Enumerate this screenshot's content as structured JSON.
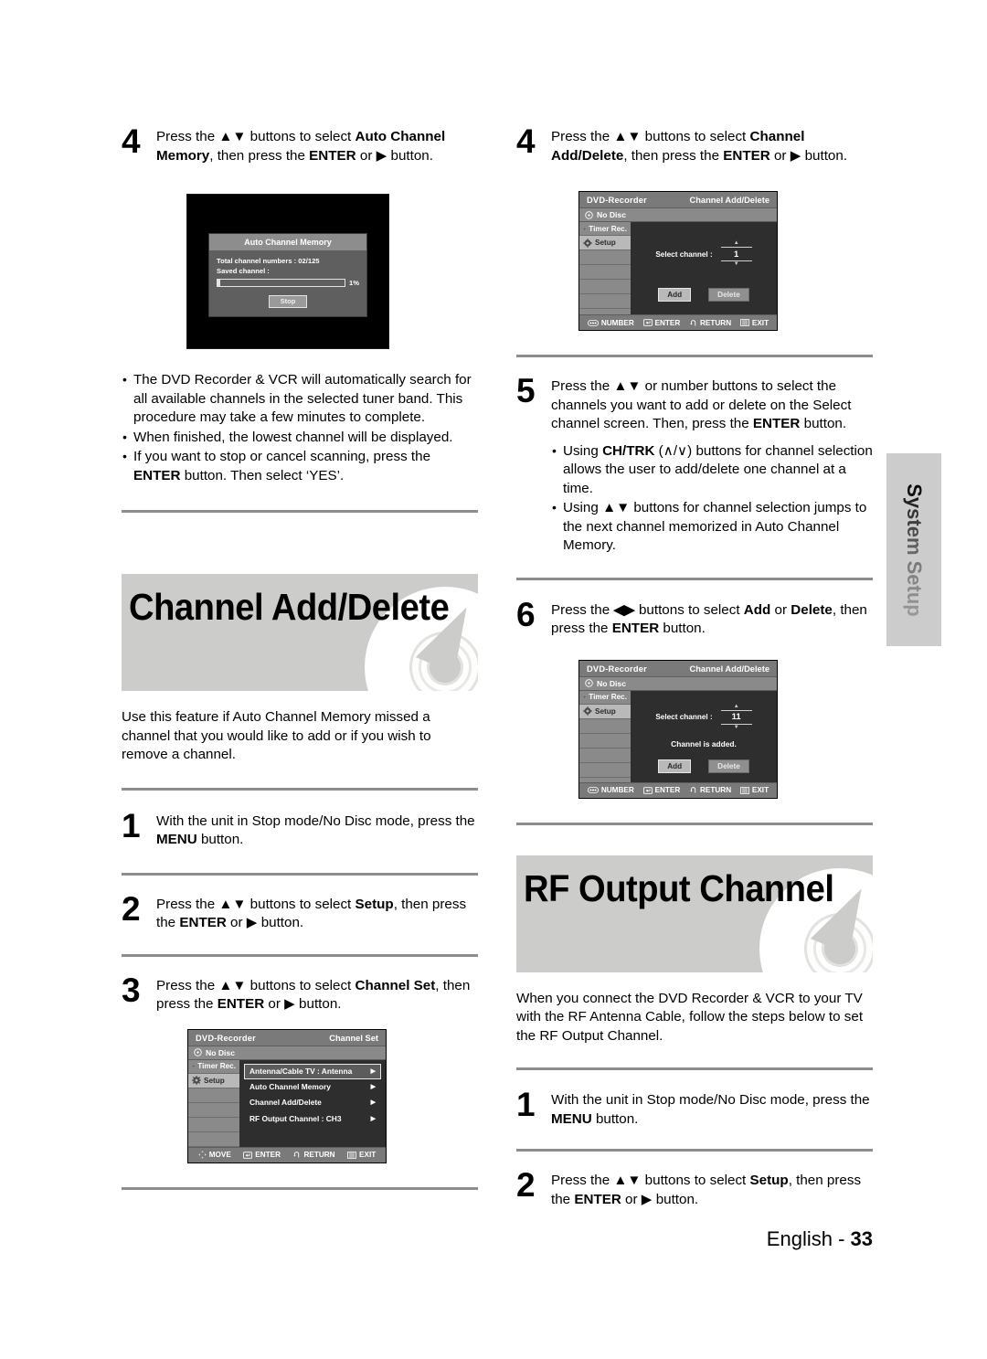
{
  "page": {
    "footer_label": "English -",
    "footer_number": "33",
    "side_tab": "System Setup"
  },
  "left_column": {
    "step4": {
      "number": "4",
      "text_parts": [
        "Press the ",
        "▲▼",
        " buttons to select ",
        "Auto Channel Memory",
        ", then press the ",
        "ENTER",
        " or ",
        "▶",
        " button."
      ],
      "line1_pre": "Press the ",
      "arrows": "▲▼",
      "line1_mid": " buttons to select ",
      "bold1": "Auto Channel",
      "line2_bold": "Memory",
      "line2_mid": ", then press the ",
      "bold2": "ENTER",
      "line2_or": " or ",
      "playglyph": "▶",
      "line2_end": " button."
    },
    "acm_screen": {
      "title": "Auto Channel Memory",
      "total_label": "Total channel numbers : 02/125",
      "saved_label": "Saved channel :",
      "percent": "1%",
      "progress_value": 1,
      "stop_button": "Stop"
    },
    "notes": [
      "The DVD Recorder & VCR will automatically search for all available channels in the selected tuner band. This procedure may take a few minutes to complete.",
      "When finished, the lowest channel will be displayed.",
      "If you want to stop or cancel scanning, press the ENTER button. Then select ‘YES’."
    ],
    "note3_pre": "If you want to stop or cancel scanning, press the ",
    "note3_bold": "ENTER",
    "note3_post": " button. Then select ‘YES’.",
    "banner": {
      "title": "Channel Add/Delete"
    },
    "intro": "Use this feature if Auto Channel Memory missed a channel that you would like to add or if you wish to remove a channel.",
    "step1": {
      "number": "1",
      "pre": "With the unit in Stop mode/No Disc mode, press the ",
      "bold": "MENU",
      "post": " button."
    },
    "step2": {
      "number": "2",
      "pre": "Press the ",
      "arrows": "▲▼",
      "mid": " buttons to select ",
      "bold": "Setup",
      "mid2": ", then press the ",
      "bold2": "ENTER",
      "or": " or ",
      "play": "▶",
      "post": " button."
    },
    "step3": {
      "number": "3",
      "pre": "Press the ",
      "arrows": "▲▼",
      "mid": " buttons to select ",
      "bold": "Channel Set",
      "mid2": ", then press the ",
      "bold2": "ENTER",
      "or": " or ",
      "play": "▶",
      "post": " button."
    },
    "channel_set_screen": {
      "model": "DVD-Recorder",
      "screen_title": "Channel Set",
      "disc_status": "No Disc",
      "sidebar": [
        "Timer Rec.",
        "Setup"
      ],
      "menu_rows": [
        {
          "label": "Antenna/Cable TV   : Antenna",
          "selected": true
        },
        {
          "label": "Auto Channel Memory",
          "selected": false
        },
        {
          "label": "Channel Add/Delete",
          "selected": false
        },
        {
          "label": "RF Output Channel  : CH3",
          "selected": false
        }
      ],
      "footer": [
        "MOVE",
        "ENTER",
        "RETURN",
        "EXIT"
      ]
    }
  },
  "right_column": {
    "step4": {
      "number": "4",
      "pre": "Press the ",
      "arrows": "▲▼",
      "mid": " buttons to select ",
      "bold": "Channel Add/Delete",
      "mid2": ", then press the ",
      "bold2": "ENTER",
      "or": " or ",
      "play": "▶",
      "post": " button."
    },
    "add_delete_screen_1": {
      "model": "DVD-Recorder",
      "screen_title": "Channel Add/Delete",
      "disc_status": "No Disc",
      "sidebar": [
        "Timer Rec.",
        "Setup"
      ],
      "select_label": "Select channel   :",
      "channel_value": "1",
      "message": "",
      "add_button": "Add",
      "delete_button": "Delete",
      "footer": [
        "NUMBER",
        "ENTER",
        "RETURN",
        "EXIT"
      ]
    },
    "step5": {
      "number": "5",
      "pre": "Press the ",
      "arrows": "▲▼",
      "mid": " or number buttons to select the channels you want to add or delete on the Select channel screen. Then, press the ",
      "bold": "ENTER",
      "post": " button.",
      "bullets": [
        "Using CH/TRK (∧/∨) buttons for channel selection allows the user to add/delete one channel at a time.",
        "Using ▲▼ buttons for channel selection jumps to the next channel memorized in Auto Channel Memory."
      ],
      "bullet1_pre": "Using ",
      "bullet1_bold": "CH/TRK",
      "bullet1_post": " (∧/∨) buttons for channel selection allows the user to add/delete one channel at a time.",
      "bullet2_pre": "Using ",
      "bullet2_arrows": "▲▼",
      "bullet2_post": " buttons for channel selection jumps to the next channel memorized in Auto Channel Memory."
    },
    "step6": {
      "number": "6",
      "pre": "Press the ",
      "arrows": "◀▶",
      "mid": " buttons to select ",
      "bold": "Add",
      "or": " or ",
      "bold2": "Delete",
      "mid2": ", then press the ",
      "bold3": "ENTER",
      "post": " button."
    },
    "add_delete_screen_2": {
      "model": "DVD-Recorder",
      "screen_title": "Channel Add/Delete",
      "disc_status": "No Disc",
      "sidebar": [
        "Timer Rec.",
        "Setup"
      ],
      "select_label": "Select channel   :",
      "channel_value": "11",
      "message": "Channel is added.",
      "add_button": "Add",
      "delete_button": "Delete",
      "footer": [
        "NUMBER",
        "ENTER",
        "RETURN",
        "EXIT"
      ]
    },
    "banner": {
      "title": "RF Output Channel"
    },
    "intro": "When you connect the DVD Recorder & VCR to your TV with the RF Antenna Cable, follow the steps below to set the RF Output Channel.",
    "step1": {
      "number": "1",
      "pre": "With the unit in Stop mode/No Disc mode, press the ",
      "bold": "MENU",
      "post": " button."
    },
    "step2": {
      "number": "2",
      "pre": "Press the ",
      "arrows": "▲▼",
      "mid": " buttons to select ",
      "bold": "Setup",
      "mid2": ", then press the ",
      "bold2": "ENTER",
      "or": " or ",
      "play": "▶",
      "post": " button."
    }
  }
}
